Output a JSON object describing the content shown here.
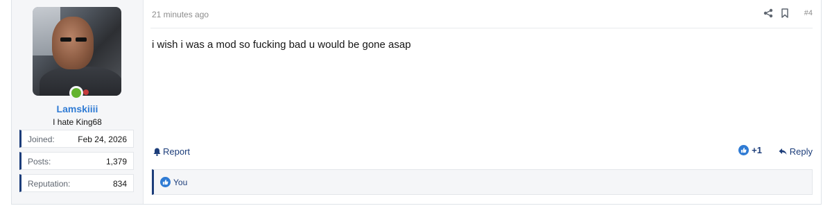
{
  "user": {
    "username": "Lamskiiii",
    "title": "I hate King68",
    "status": "online",
    "stats": [
      {
        "label": "Joined:",
        "value": "Feb 24, 2026"
      },
      {
        "label": "Posts:",
        "value": "1,379"
      },
      {
        "label": "Reputation:",
        "value": "834"
      }
    ]
  },
  "post": {
    "time": "21 minutes ago",
    "number": "#4",
    "message": "i wish i was a mod so fucking bad u would be gone asap",
    "report_label": "Report",
    "like_count": "+1",
    "reply_label": "Reply",
    "reactions_text": "You"
  },
  "icons": {
    "share": "share-icon",
    "bookmark": "bookmark-icon",
    "report": "bell-icon",
    "reply": "reply-arrow-icon",
    "like": "thumbs-up-icon"
  },
  "colors": {
    "accent": "#1c3d7a",
    "username": "#2f7bd4",
    "online": "#63b32e",
    "like": "#2f7bd4"
  }
}
